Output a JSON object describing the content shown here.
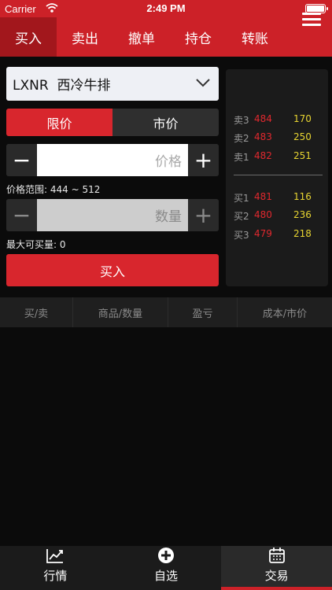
{
  "status": {
    "carrier": "Carrier",
    "time": "2:49 PM"
  },
  "tabs": [
    {
      "label": "买入"
    },
    {
      "label": "卖出"
    },
    {
      "label": "撤单"
    },
    {
      "label": "持仓"
    },
    {
      "label": "转账"
    }
  ],
  "symbol": {
    "text": "LXNR  西冷牛排"
  },
  "price_type": {
    "limit": "限价",
    "market": "市价"
  },
  "price": {
    "placeholder": "价格",
    "minus": "−",
    "plus": "+"
  },
  "price_range": "价格范围: 444 ~ 512",
  "quantity": {
    "placeholder": "数量",
    "minus": "−",
    "plus": "+"
  },
  "max_buy": "最大可买量: 0",
  "buy_button": "买入",
  "order_book": {
    "asks": [
      {
        "label": "卖3",
        "price": "484",
        "qty": "170"
      },
      {
        "label": "卖2",
        "price": "483",
        "qty": "250"
      },
      {
        "label": "卖1",
        "price": "482",
        "qty": "251"
      }
    ],
    "bids": [
      {
        "label": "买1",
        "price": "481",
        "qty": "116"
      },
      {
        "label": "买2",
        "price": "480",
        "qty": "236"
      },
      {
        "label": "买3",
        "price": "479",
        "qty": "218"
      }
    ]
  },
  "holdings_header": [
    "买/卖",
    "商品/数量",
    "盈亏",
    "成本/市价"
  ],
  "bottom_nav": [
    {
      "label": "行情",
      "icon": "chart-icon"
    },
    {
      "label": "自选",
      "icon": "add-circle-icon"
    },
    {
      "label": "交易",
      "icon": "calendar-icon"
    }
  ],
  "colors": {
    "brand_red": "#cc2128",
    "ask_bid_price": "#e0282e",
    "qty": "#e8d531"
  }
}
